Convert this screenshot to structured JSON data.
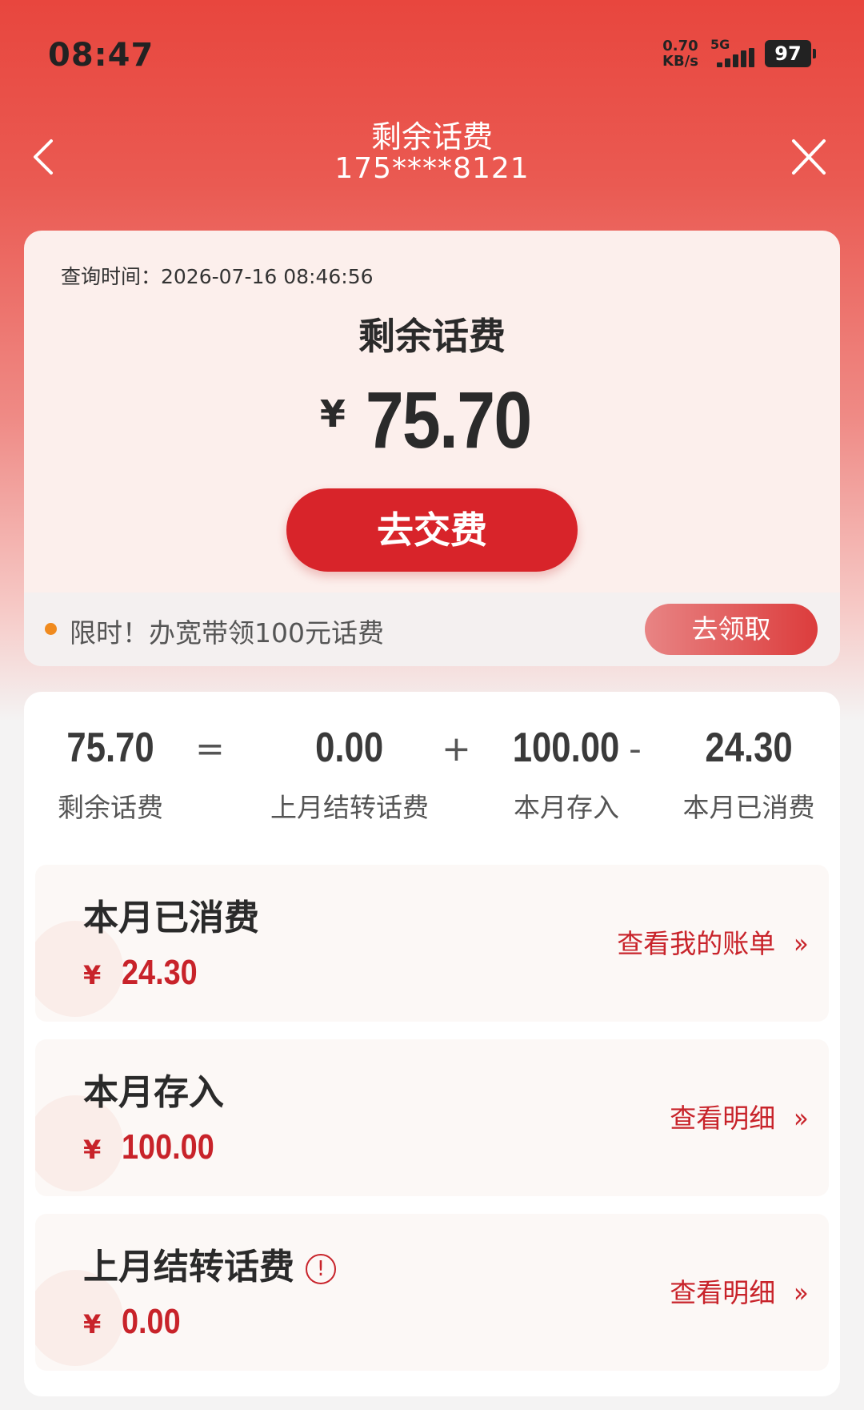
{
  "status_bar": {
    "time": "08:47",
    "net_speed_value": "0.70",
    "net_speed_unit": "KB/s",
    "network": "5G",
    "battery": "97"
  },
  "header": {
    "title": "剩余话费",
    "phone": "175****8121",
    "back_icon": "chevron-left-icon",
    "close_icon": "close-icon"
  },
  "balance_card": {
    "query_time": "查询时间：2026-07-16 08:46:56",
    "title": "剩余话费",
    "currency": "¥",
    "amount": "75.70",
    "pay_button": "去交费"
  },
  "promo": {
    "text": "限时！办宽带领100元话费",
    "button": "去领取",
    "dot_color": "#f08a1e"
  },
  "equation": {
    "items": [
      {
        "value": "75.70",
        "label": "剩余话费"
      },
      {
        "value": "0.00",
        "label": "上月结转话费"
      },
      {
        "value": "100.00",
        "label": "本月存入"
      },
      {
        "value": "24.30",
        "label": "本月已消费"
      }
    ],
    "operators": [
      "=",
      "+",
      "-"
    ]
  },
  "details": [
    {
      "title": "本月已消费",
      "currency": "¥",
      "amount": "24.30",
      "link": "查看我的账单",
      "chevron": "»"
    },
    {
      "title": "本月存入",
      "currency": "¥",
      "amount": "100.00",
      "link": "查看明细",
      "chevron": "»"
    },
    {
      "title": "上月结转话费",
      "currency": "¥",
      "amount": "0.00",
      "link": "查看明细",
      "chevron": "»",
      "info": "!"
    }
  ],
  "colors": {
    "accent": "#d8242a",
    "header_bg": "#e8463e",
    "amount_text": "#c8232a"
  }
}
